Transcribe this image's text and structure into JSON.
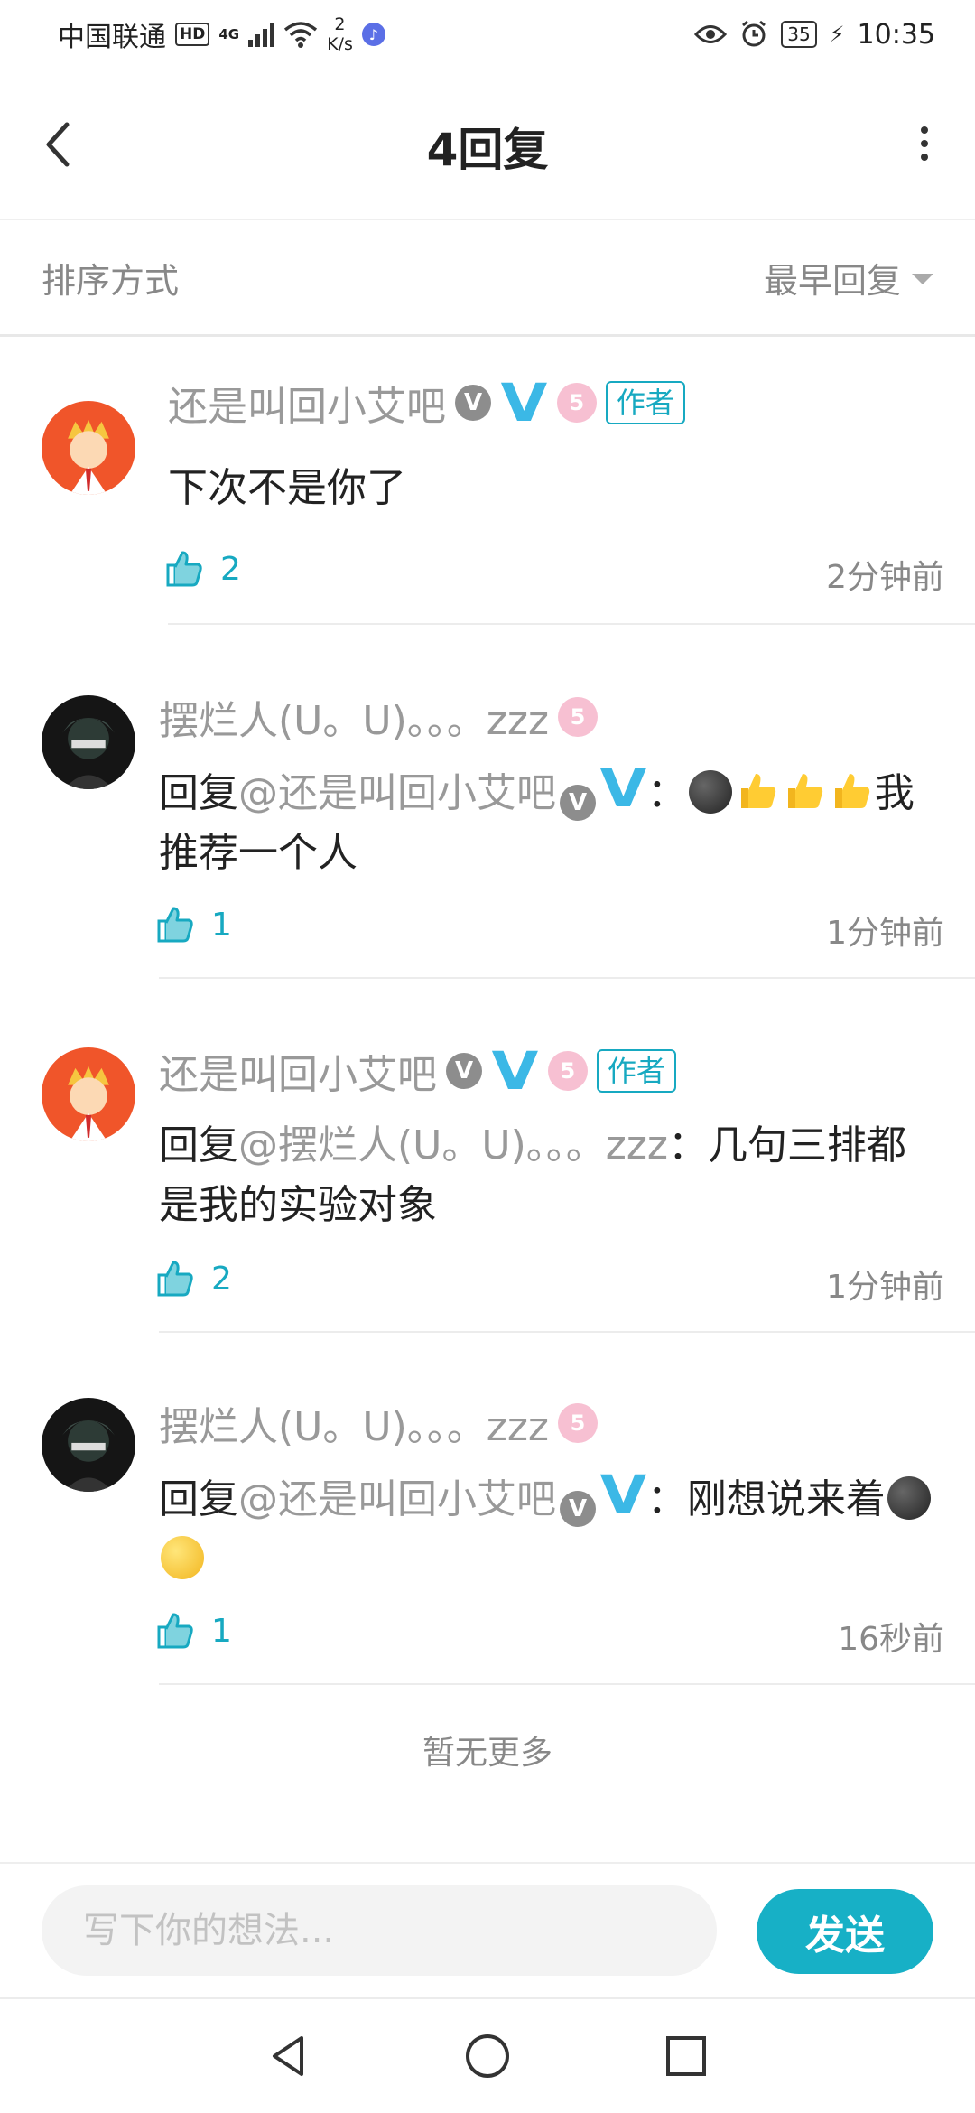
{
  "status_bar": {
    "carrier": "中国联通",
    "hd": "HD",
    "net_type": "4G",
    "speed_value": "2",
    "speed_unit": "K/s",
    "battery": "35",
    "time": "10:35"
  },
  "header": {
    "title": "4回复"
  },
  "sort": {
    "label": "排序方式",
    "value": "最早回复"
  },
  "badges": {
    "v_grey": "V",
    "v_blue": "V",
    "level": "5",
    "author": "作者"
  },
  "replies": [
    {
      "username": "还是叫回小艾吧",
      "is_author": true,
      "content": "下次不是你了",
      "likes": "2",
      "time": "2分钟前"
    },
    {
      "username": "摆烂人(U。U)。。。zzz",
      "is_author": false,
      "reply_prefix": "回复",
      "mention": "@还是叫回小艾吧",
      "colon": "：",
      "content": "我推荐一个人",
      "likes": "1",
      "time": "1分钟前"
    },
    {
      "username": "还是叫回小艾吧",
      "is_author": true,
      "reply_prefix": "回复",
      "mention": "@摆烂人(U。U)。。。zzz",
      "colon": "：",
      "content": "几句三排都是我的实验对象",
      "likes": "2",
      "time": "1分钟前"
    },
    {
      "username": "摆烂人(U。U)。。。zzz",
      "is_author": false,
      "reply_prefix": "回复",
      "mention": "@还是叫回小艾吧",
      "colon": "：",
      "content": "刚想说来着",
      "likes": "1",
      "time": "16秒前"
    }
  ],
  "footer": {
    "no_more": "暂无更多"
  },
  "composer": {
    "placeholder": "写下你的想法...",
    "send_label": "发送"
  },
  "colors": {
    "accent": "#17b0c6",
    "v_blue": "#3bb8e6",
    "level_pink": "#f7c0d2",
    "muted_text": "#999999"
  }
}
